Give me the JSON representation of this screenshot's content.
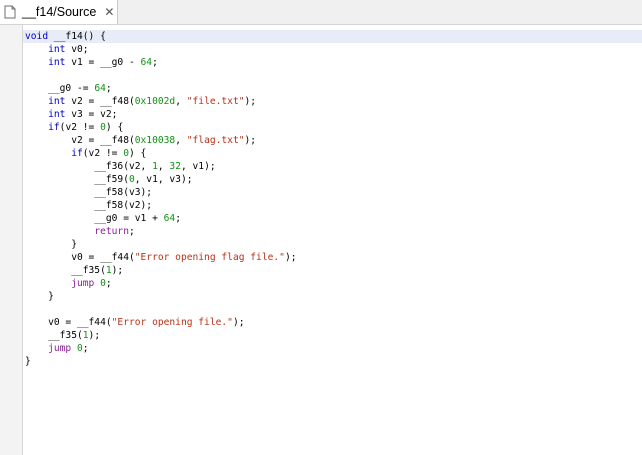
{
  "tab": {
    "title": "__f14/Source",
    "close": "✕",
    "icon": "document-icon"
  },
  "colors": {
    "keyword": "#0000c8",
    "number": "#128f12",
    "string": "#b8321a",
    "control": "#8a1f9a"
  },
  "code_lines": [
    [
      {
        "t": "void",
        "c": "kw"
      },
      {
        "t": " __f14() {",
        "c": "plain"
      }
    ],
    [
      {
        "t": "    ",
        "c": "plain"
      },
      {
        "t": "int",
        "c": "kw"
      },
      {
        "t": " v0;",
        "c": "plain"
      }
    ],
    [
      {
        "t": "    ",
        "c": "plain"
      },
      {
        "t": "int",
        "c": "kw"
      },
      {
        "t": " v1 = __g0 - ",
        "c": "plain"
      },
      {
        "t": "64",
        "c": "num"
      },
      {
        "t": ";",
        "c": "plain"
      }
    ],
    [],
    [
      {
        "t": "    __g0 -= ",
        "c": "plain"
      },
      {
        "t": "64",
        "c": "num"
      },
      {
        "t": ";",
        "c": "plain"
      }
    ],
    [
      {
        "t": "    ",
        "c": "plain"
      },
      {
        "t": "int",
        "c": "kw"
      },
      {
        "t": " v2 = __f48(",
        "c": "plain"
      },
      {
        "t": "0x1002d",
        "c": "num"
      },
      {
        "t": ", ",
        "c": "plain"
      },
      {
        "t": "\"file.txt\"",
        "c": "str"
      },
      {
        "t": ");",
        "c": "plain"
      }
    ],
    [
      {
        "t": "    ",
        "c": "plain"
      },
      {
        "t": "int",
        "c": "kw"
      },
      {
        "t": " v3 = v2;",
        "c": "plain"
      }
    ],
    [
      {
        "t": "    ",
        "c": "plain"
      },
      {
        "t": "if",
        "c": "kw"
      },
      {
        "t": "(v2 != ",
        "c": "plain"
      },
      {
        "t": "0",
        "c": "num"
      },
      {
        "t": ") {",
        "c": "plain"
      }
    ],
    [
      {
        "t": "        v2 = __f48(",
        "c": "plain"
      },
      {
        "t": "0x10038",
        "c": "num"
      },
      {
        "t": ", ",
        "c": "plain"
      },
      {
        "t": "\"flag.txt\"",
        "c": "str"
      },
      {
        "t": ");",
        "c": "plain"
      }
    ],
    [
      {
        "t": "        ",
        "c": "plain"
      },
      {
        "t": "if",
        "c": "kw"
      },
      {
        "t": "(v2 != ",
        "c": "plain"
      },
      {
        "t": "0",
        "c": "num"
      },
      {
        "t": ") {",
        "c": "plain"
      }
    ],
    [
      {
        "t": "            __f36(v2, ",
        "c": "plain"
      },
      {
        "t": "1",
        "c": "num"
      },
      {
        "t": ", ",
        "c": "plain"
      },
      {
        "t": "32",
        "c": "num"
      },
      {
        "t": ", v1);",
        "c": "plain"
      }
    ],
    [
      {
        "t": "            __f59(",
        "c": "plain"
      },
      {
        "t": "0",
        "c": "num"
      },
      {
        "t": ", v1, v3);",
        "c": "plain"
      }
    ],
    [
      {
        "t": "            __f58(v3);",
        "c": "plain"
      }
    ],
    [
      {
        "t": "            __f58(v2);",
        "c": "plain"
      }
    ],
    [
      {
        "t": "            __g0 = v1 + ",
        "c": "plain"
      },
      {
        "t": "64",
        "c": "num"
      },
      {
        "t": ";",
        "c": "plain"
      }
    ],
    [
      {
        "t": "            ",
        "c": "plain"
      },
      {
        "t": "return",
        "c": "ctl"
      },
      {
        "t": ";",
        "c": "plain"
      }
    ],
    [
      {
        "t": "        }",
        "c": "plain"
      }
    ],
    [
      {
        "t": "        v0 = __f44(",
        "c": "plain"
      },
      {
        "t": "\"Error opening flag file.\"",
        "c": "str"
      },
      {
        "t": ");",
        "c": "plain"
      }
    ],
    [
      {
        "t": "        __f35(",
        "c": "plain"
      },
      {
        "t": "1",
        "c": "num"
      },
      {
        "t": ");",
        "c": "plain"
      }
    ],
    [
      {
        "t": "        ",
        "c": "plain"
      },
      {
        "t": "jump",
        "c": "ctl"
      },
      {
        "t": " ",
        "c": "plain"
      },
      {
        "t": "0",
        "c": "num"
      },
      {
        "t": ";",
        "c": "plain"
      }
    ],
    [
      {
        "t": "    }",
        "c": "plain"
      }
    ],
    [],
    [
      {
        "t": "    v0 = __f44(",
        "c": "plain"
      },
      {
        "t": "\"Error opening file.\"",
        "c": "str"
      },
      {
        "t": ");",
        "c": "plain"
      }
    ],
    [
      {
        "t": "    __f35(",
        "c": "plain"
      },
      {
        "t": "1",
        "c": "num"
      },
      {
        "t": ");",
        "c": "plain"
      }
    ],
    [
      {
        "t": "    ",
        "c": "plain"
      },
      {
        "t": "jump",
        "c": "ctl"
      },
      {
        "t": " ",
        "c": "plain"
      },
      {
        "t": "0",
        "c": "num"
      },
      {
        "t": ";",
        "c": "plain"
      }
    ],
    [
      {
        "t": "}",
        "c": "plain"
      }
    ]
  ]
}
